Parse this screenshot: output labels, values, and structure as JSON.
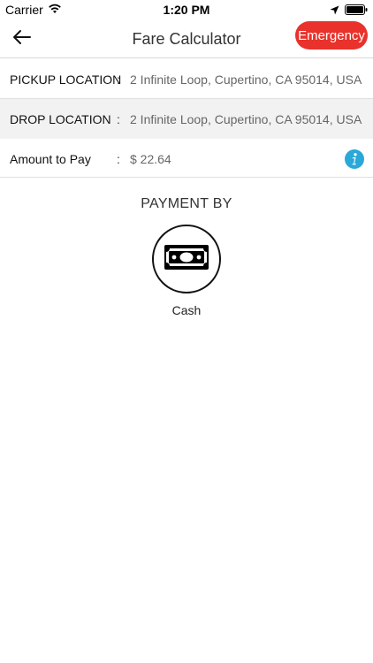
{
  "status_bar": {
    "carrier": "Carrier",
    "time": "1:20 PM"
  },
  "nav": {
    "title": "Fare Calculator",
    "emergency_label": "Emergency",
    "emergency_color": "#e8322b"
  },
  "rows": {
    "pickup": {
      "label": "PICKUP LOCATION",
      "separator": ":",
      "value": "2 Infinite Loop, Cupertino, CA 95014, USA"
    },
    "drop": {
      "label": "DROP LOCATION",
      "separator": ":",
      "value": "2 Infinite Loop, Cupertino, CA 95014, USA"
    },
    "amount": {
      "label": "Amount to Pay",
      "separator": ":",
      "value": "$ 22.64",
      "icon": "info-icon"
    }
  },
  "payment": {
    "title": "PAYMENT BY",
    "methods": [
      {
        "label": "Cash",
        "icon": "cash-icon"
      }
    ]
  },
  "colors": {
    "accent_info": "#2aa8d8",
    "shaded_row": "#f2f2f2"
  }
}
